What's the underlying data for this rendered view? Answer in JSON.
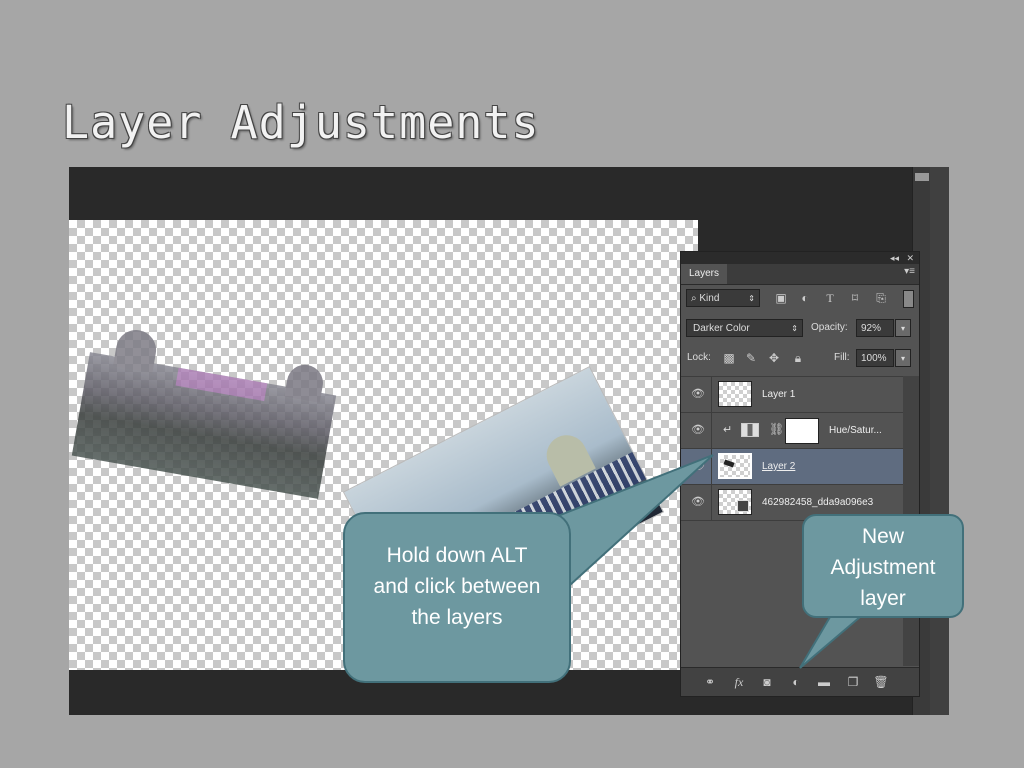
{
  "slide": {
    "title": "Layer Adjustments"
  },
  "layers_panel": {
    "tab_label": "Layers",
    "collapse_glyph": "◂◂",
    "close_glyph": "✕",
    "menu_glyph": "▾≡",
    "filter": {
      "kind_label": "⌕ Kind",
      "icons": [
        "image-filter-icon",
        "adjustment-filter-icon",
        "type-filter-icon",
        "shape-filter-icon",
        "smart-object-filter-icon"
      ]
    },
    "blend_mode": "Darker Color",
    "opacity_label": "Opacity:",
    "opacity_value": "92%",
    "lock_label": "Lock:",
    "fill_label": "Fill:",
    "fill_value": "100%",
    "layers": [
      {
        "name": "Layer 1",
        "visible": true,
        "selected": false
      },
      {
        "name": "Hue/Satur...",
        "visible": true,
        "selected": false,
        "type": "adjustment",
        "clipped": true
      },
      {
        "name": "Layer 2",
        "visible": true,
        "selected": true
      },
      {
        "name": "462982458_dda9a096e3",
        "visible": true,
        "selected": false
      }
    ],
    "bottom_icons": [
      "link-layers-icon",
      "fx-icon",
      "add-mask-icon",
      "new-adjustment-layer-icon",
      "new-group-icon",
      "new-layer-icon",
      "delete-layer-icon"
    ]
  },
  "callouts": {
    "alt_click": "Hold down ALT and click between the layers",
    "new_adjustment": "New Adjustment layer"
  },
  "colors": {
    "slide_bg": "#a6a6a6",
    "callout_fill": "#6d98a0",
    "callout_border": "#42707a",
    "selected_layer": "#5f6c80"
  }
}
